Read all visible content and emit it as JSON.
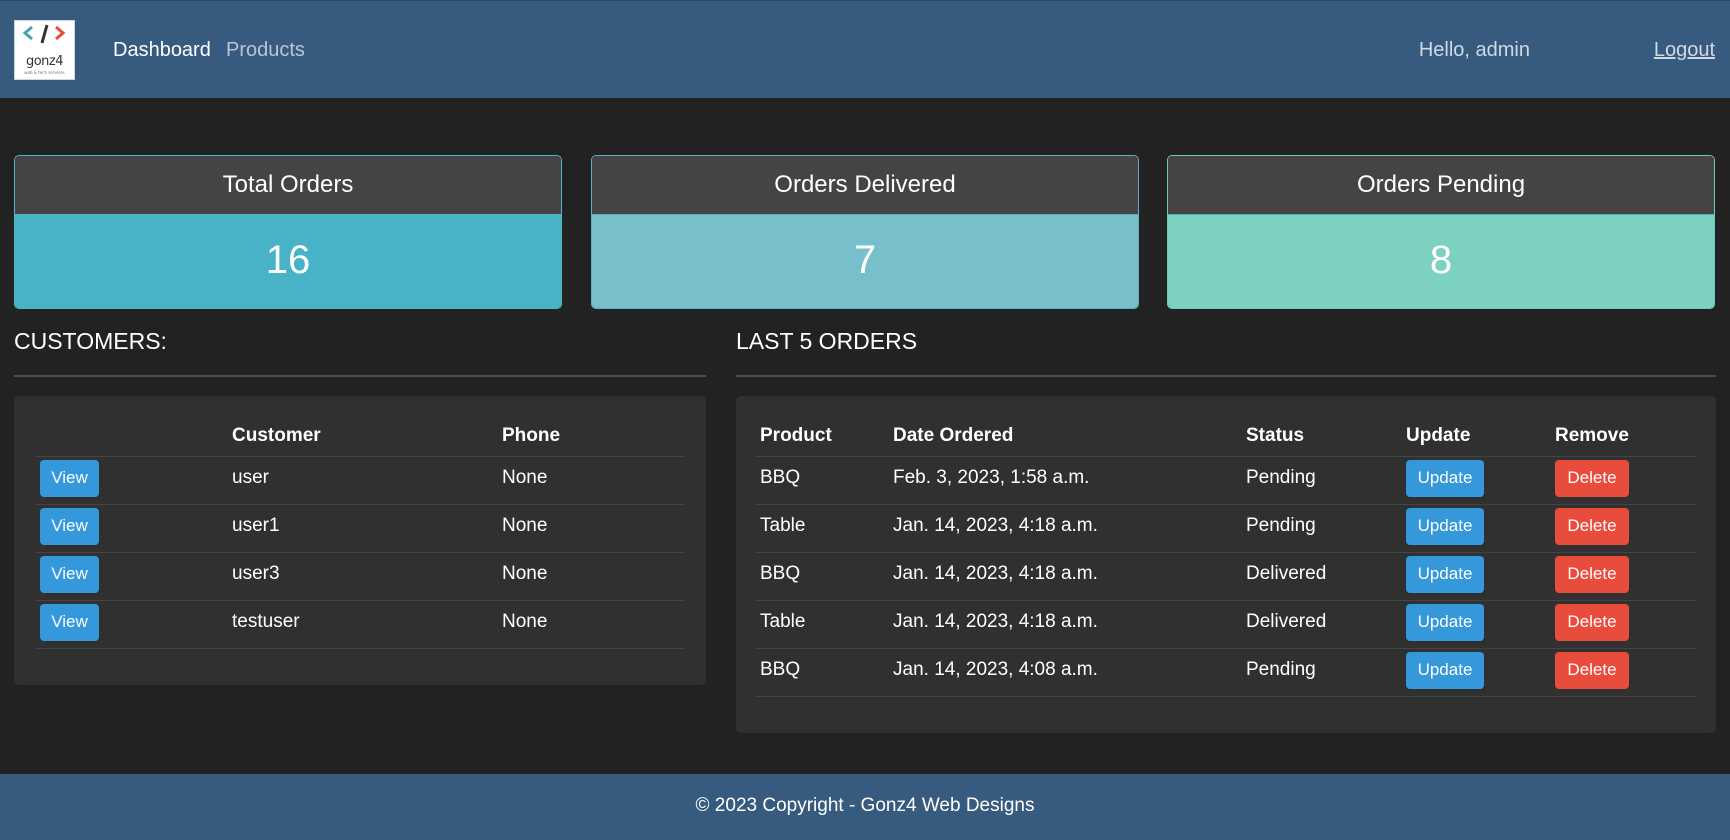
{
  "navbar": {
    "logo_text": "gonz4",
    "logo_subtext": "web & tech services",
    "links": [
      {
        "label": "Dashboard",
        "active": true
      },
      {
        "label": "Products",
        "active": false
      }
    ],
    "greeting": "Hello, admin",
    "logout_label": "Logout"
  },
  "stats": [
    {
      "title": "Total Orders",
      "value": "16",
      "color": "#48b3c7"
    },
    {
      "title": "Orders Delivered",
      "value": "7",
      "color": "#77bfcb"
    },
    {
      "title": "Orders Pending",
      "value": "8",
      "color": "#7dd1c1"
    }
  ],
  "customers": {
    "heading": "CUSTOMERS:",
    "columns": [
      "",
      "Customer",
      "Phone"
    ],
    "view_label": "View",
    "rows": [
      {
        "customer": "user",
        "phone": "None"
      },
      {
        "customer": "user1",
        "phone": "None"
      },
      {
        "customer": "user3",
        "phone": "None"
      },
      {
        "customer": "testuser",
        "phone": "None"
      }
    ]
  },
  "orders": {
    "heading": "LAST 5 ORDERS",
    "columns": [
      "Product",
      "Date Ordered",
      "Status",
      "Update",
      "Remove"
    ],
    "update_label": "Update",
    "delete_label": "Delete",
    "rows": [
      {
        "product": "BBQ",
        "date": "Feb. 3, 2023, 1:58 a.m.",
        "status": "Pending"
      },
      {
        "product": "Table",
        "date": "Jan. 14, 2023, 4:18 a.m.",
        "status": "Pending"
      },
      {
        "product": "BBQ",
        "date": "Jan. 14, 2023, 4:18 a.m.",
        "status": "Delivered"
      },
      {
        "product": "Table",
        "date": "Jan. 14, 2023, 4:18 a.m.",
        "status": "Delivered"
      },
      {
        "product": "BBQ",
        "date": "Jan. 14, 2023, 4:08 a.m.",
        "status": "Pending"
      }
    ]
  },
  "footer": {
    "text": "© 2023 Copyright - Gonz4 Web Designs"
  },
  "colors": {
    "navbar": "#375a7f",
    "background": "#222222",
    "panel": "#303030",
    "primary_button": "#3498db",
    "danger_button": "#e74c3c"
  }
}
